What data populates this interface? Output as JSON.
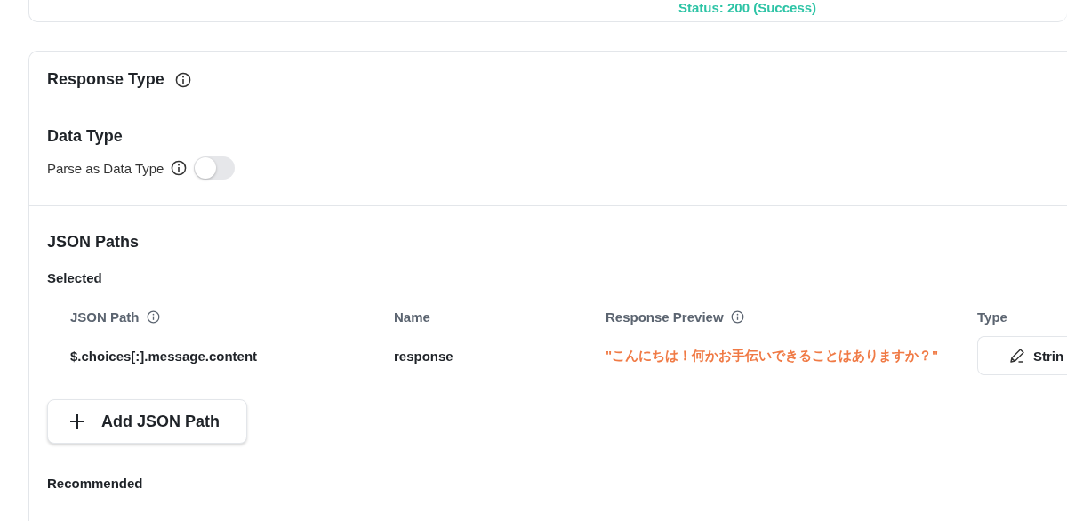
{
  "top_card": {
    "status": "Status: 200 (Success)"
  },
  "response_type": {
    "title": "Response Type"
  },
  "data_type": {
    "title": "Data Type",
    "parse_label": "Parse as Data Type",
    "parse_on": false
  },
  "json_paths": {
    "title": "JSON Paths",
    "selected_label": "Selected",
    "columns": [
      {
        "label": "JSON Path",
        "info": true
      },
      {
        "label": "Name",
        "info": false
      },
      {
        "label": "Response Preview",
        "info": true
      },
      {
        "label": "Type",
        "info": false
      }
    ],
    "rows": [
      {
        "path": "$.choices[:].message.content",
        "name": "response",
        "preview": "\"こんにちは！何かお手伝いできることはありますか？\"",
        "type": "Strin"
      }
    ],
    "add_button": "Add JSON Path",
    "recommended_label": "Recommended"
  }
}
